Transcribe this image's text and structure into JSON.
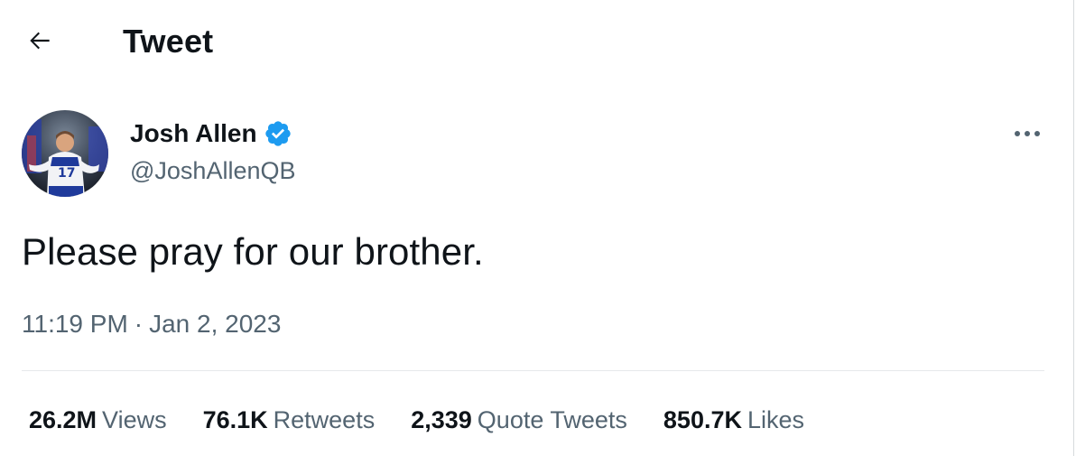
{
  "header": {
    "title": "Tweet",
    "back_icon": "arrow-left-icon"
  },
  "author": {
    "name": "Josh Allen",
    "handle": "@JoshAllenQB",
    "verified": true,
    "verified_color": "#1d9bf0",
    "avatar_icon": "avatar"
  },
  "tweet": {
    "text": "Please pray for our brother.",
    "time": "11:19 PM",
    "separator": "·",
    "date": "Jan 2, 2023"
  },
  "stats": {
    "views": {
      "value": "26.2M",
      "label": "Views"
    },
    "retweets": {
      "value": "76.1K",
      "label": "Retweets"
    },
    "quote_tweets": {
      "value": "2,339",
      "label": "Quote Tweets"
    },
    "likes": {
      "value": "850.7K",
      "label": "Likes"
    }
  },
  "colors": {
    "text_primary": "#0f1419",
    "text_secondary": "#536471",
    "divider": "#e6e9eb",
    "accent": "#1d9bf0"
  }
}
